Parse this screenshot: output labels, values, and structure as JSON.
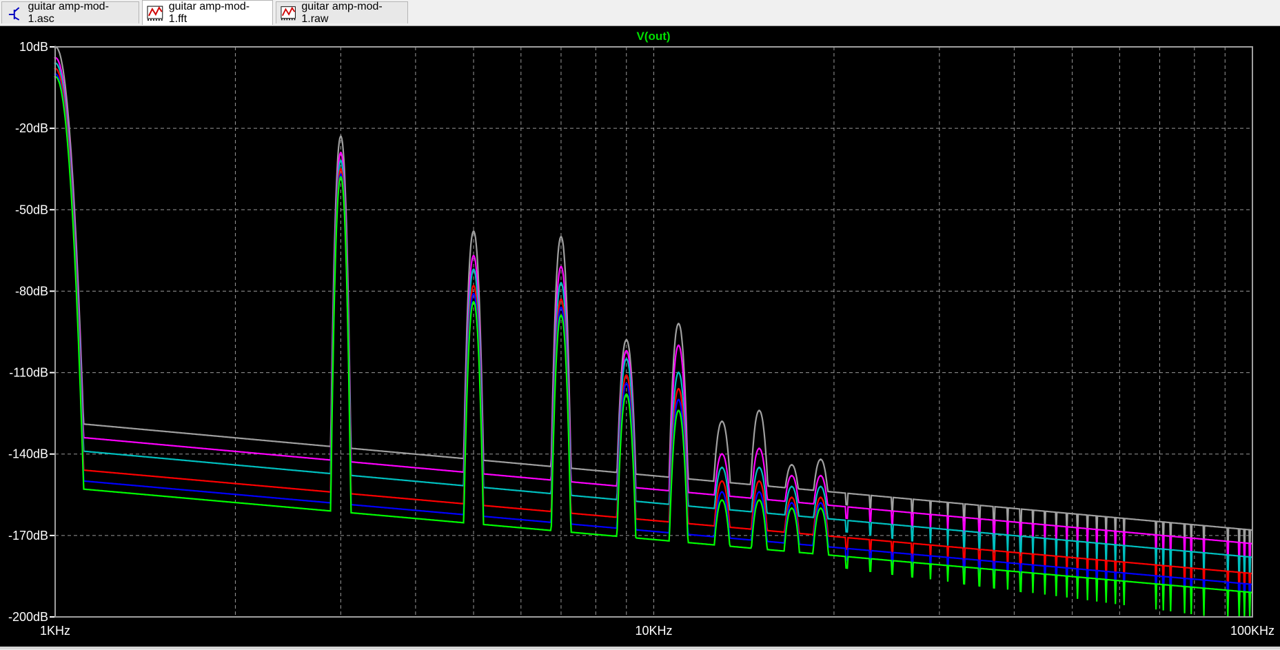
{
  "tabs": [
    {
      "label": "guitar amp-mod-1.asc",
      "icon": "schematic-icon",
      "active": false
    },
    {
      "label": "guitar amp-mod-1.fft",
      "icon": "waveform-icon",
      "active": true
    },
    {
      "label": "guitar amp-mod-1.raw",
      "icon": "waveform-icon",
      "active": false
    }
  ],
  "colors": {
    "background": "#000000",
    "grid": "#9a9a9a",
    "axis_text": "#ffffff",
    "trace_title": "#00e000"
  },
  "chart_data": {
    "type": "line",
    "title": "V(out)",
    "x_scale": "log",
    "xlim": [
      1000,
      100000
    ],
    "ylim": [
      -200,
      10
    ],
    "x_ticks": [
      {
        "value": 1000,
        "label": "1KHz"
      },
      {
        "value": 10000,
        "label": "10KHz"
      },
      {
        "value": 100000,
        "label": "100KHz"
      }
    ],
    "y_ticks": [
      {
        "value": 10,
        "label": "10dB"
      },
      {
        "value": -20,
        "label": "-20dB"
      },
      {
        "value": -50,
        "label": "-50dB"
      },
      {
        "value": -80,
        "label": "-80dB"
      },
      {
        "value": -110,
        "label": "-110dB"
      },
      {
        "value": -140,
        "label": "-140dB"
      },
      {
        "value": -170,
        "label": "-170dB"
      },
      {
        "value": -200,
        "label": "-200dB"
      }
    ],
    "grid": true,
    "peak_frequencies_hz": [
      1000,
      3000,
      5000,
      7000,
      9000,
      11000,
      13000,
      15000,
      17000,
      19000
    ],
    "series": [
      {
        "color": "#a0a0a0",
        "peak_values_db": [
          10,
          -23,
          -58,
          -60,
          -98,
          -92,
          -128,
          -124,
          -144,
          -142
        ],
        "floor_start_db": -128,
        "floor_end_db": -168
      },
      {
        "color": "#ff00ff",
        "peak_values_db": [
          6,
          -29,
          -67,
          -71,
          -102,
          -100,
          -140,
          -138,
          -148,
          -148
        ],
        "floor_start_db": -133,
        "floor_end_db": -173
      },
      {
        "color": "#00c0c0",
        "peak_values_db": [
          4,
          -32,
          -72,
          -77,
          -105,
          -110,
          -145,
          -145,
          -152,
          -152
        ],
        "floor_start_db": -138,
        "floor_end_db": -178
      },
      {
        "color": "#ff0000",
        "peak_values_db": [
          2,
          -35,
          -78,
          -83,
          -111,
          -116,
          -150,
          -150,
          -156,
          -156
        ],
        "floor_start_db": -145,
        "floor_end_db": -184
      },
      {
        "color": "#0000ff",
        "peak_values_db": [
          0,
          -37,
          -81,
          -86,
          -114,
          -120,
          -154,
          -154,
          -158,
          -158
        ],
        "floor_start_db": -149,
        "floor_end_db": -188
      },
      {
        "color": "#00ff00",
        "peak_values_db": [
          -1,
          -38,
          -84,
          -89,
          -118,
          -124,
          -157,
          -157,
          -160,
          -160
        ],
        "floor_start_db": -152,
        "floor_end_db": -191
      }
    ]
  }
}
